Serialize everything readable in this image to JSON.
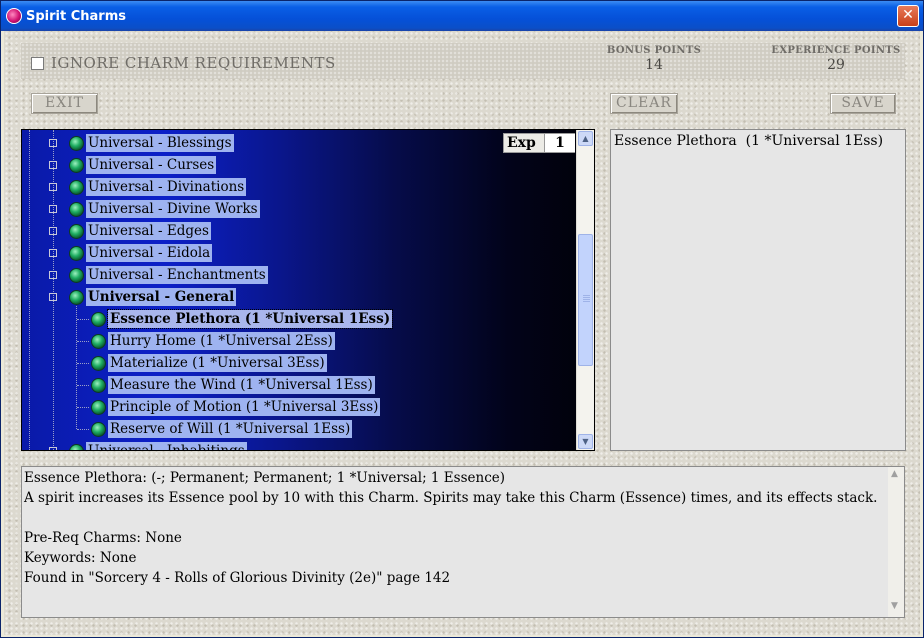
{
  "window": {
    "title": "Spirit Charms",
    "close_glyph": "✕"
  },
  "header": {
    "ignore_label": "Ignore Charm Requirements",
    "bonus_points_label": "BONUS POINTS",
    "bonus_points_value": "14",
    "experience_points_label": "EXPERIENCE POINTS",
    "experience_points_value": "29"
  },
  "buttons": {
    "exit": "Exit",
    "clear": "Clear",
    "save": "Save"
  },
  "tree": {
    "exp_label": "Exp",
    "exp_value": "1",
    "groups": [
      {
        "label": "Universal - Blessings"
      },
      {
        "label": "Universal - Curses"
      },
      {
        "label": "Universal - Divinations"
      },
      {
        "label": "Universal - Divine Works"
      },
      {
        "label": "Universal - Edges"
      },
      {
        "label": "Universal - Eidola"
      },
      {
        "label": "Universal - Enchantments"
      },
      {
        "label": "Universal - General"
      }
    ],
    "children": [
      {
        "label": "Essence Plethora  (1 *Universal 1Ess)"
      },
      {
        "label": "Hurry Home  (1 *Universal 2Ess)"
      },
      {
        "label": "Materialize  (1 *Universal 3Ess)"
      },
      {
        "label": "Measure the Wind  (1 *Universal 1Ess)"
      },
      {
        "label": "Principle of Motion  (1 *Universal 3Ess)"
      },
      {
        "label": "Reserve of Will  (1 *Universal 1Ess)"
      }
    ],
    "partial_row": {
      "label": "Universal - Inhabitings"
    }
  },
  "selected_panel": {
    "items": [
      "Essence Plethora  (1 *Universal 1Ess)"
    ]
  },
  "description": {
    "lines": [
      "Essence Plethora: (-; Permanent; Permanent; 1 *Universal; 1 Essence)",
      "A spirit increases its Essence pool by 10 with this Charm. Spirits may take this Charm (Essence) times, and its effects stack.",
      "",
      "Pre-Req Charms: None",
      "Keywords: None",
      "Found in \"Sorcery 4 - Rolls of Glorious Divinity (2e)\" page 142"
    ]
  },
  "colors": {
    "title_bar": "#0550d8",
    "tree_background": "#0a1aa8",
    "row_highlight": "#9eb3f0"
  }
}
